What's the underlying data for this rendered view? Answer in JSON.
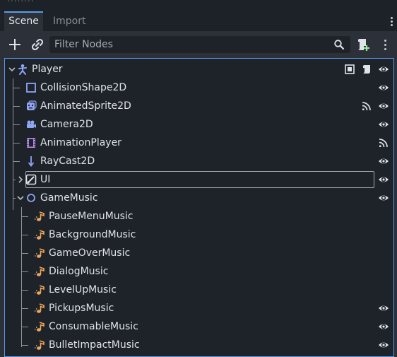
{
  "tabs": [
    {
      "label": "Scene",
      "active": true
    },
    {
      "label": "Import",
      "active": false
    }
  ],
  "toolbar": {
    "filter_placeholder": "Filter Nodes"
  },
  "colors": {
    "accent": "#5b9ae8",
    "node2d_icon": "#8da5f3",
    "control_icon": "#8eef97",
    "node_icon": "#e0e0e0",
    "animation_icon": "#c38ef1"
  },
  "tree": {
    "nodes": [
      {
        "label": "Player",
        "icon": "character-body-2d-icon",
        "expanded": true,
        "badges": [
          "script-icon",
          "script-attach-icon",
          "visibility-icon"
        ]
      },
      {
        "label": "CollisionShape2D",
        "icon": "collision-shape-2d-icon",
        "badges": [
          "visibility-icon"
        ]
      },
      {
        "label": "AnimatedSprite2D",
        "icon": "animated-sprite-2d-icon",
        "badges": [
          "signal-icon",
          "visibility-icon"
        ]
      },
      {
        "label": "Camera2D",
        "icon": "camera-2d-icon",
        "badges": [
          "visibility-icon"
        ]
      },
      {
        "label": "AnimationPlayer",
        "icon": "animation-player-icon",
        "badges": [
          "signal-icon"
        ]
      },
      {
        "label": "RayCast2D",
        "icon": "raycast-2d-icon",
        "badges": [
          "visibility-icon"
        ]
      },
      {
        "label": "UI",
        "icon": "ui-control-icon",
        "expanded": false,
        "selected": true,
        "badges": [
          "visibility-icon"
        ]
      },
      {
        "label": "GameMusic",
        "icon": "node-2d-icon",
        "expanded": true,
        "badges": [
          "visibility-icon"
        ]
      },
      {
        "label": "PauseMenuMusic",
        "icon": "audio-stream-player-icon",
        "badges": []
      },
      {
        "label": "BackgroundMusic",
        "icon": "audio-stream-player-icon",
        "badges": []
      },
      {
        "label": "GameOverMusic",
        "icon": "audio-stream-player-icon",
        "badges": []
      },
      {
        "label": "DialogMusic",
        "icon": "audio-stream-player-icon",
        "badges": []
      },
      {
        "label": "LevelUpMusic",
        "icon": "audio-stream-player-icon",
        "badges": []
      },
      {
        "label": "PickupsMusic",
        "icon": "audio-stream-player-icon",
        "badges": [
          "visibility-icon"
        ]
      },
      {
        "label": "ConsumableMusic",
        "icon": "audio-stream-player-icon",
        "badges": [
          "visibility-icon"
        ]
      },
      {
        "label": "BulletImpactMusic",
        "icon": "audio-stream-player-icon",
        "badges": [
          "visibility-icon"
        ]
      }
    ]
  }
}
